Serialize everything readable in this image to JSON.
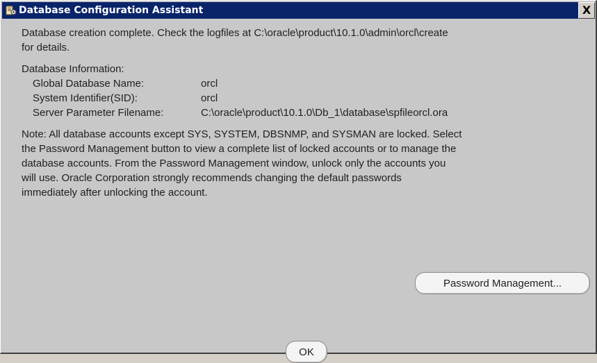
{
  "window": {
    "title": "Database Configuration Assistant",
    "close_label": "X",
    "title_icon": "database-assistant-icon"
  },
  "message": {
    "line1": "Database creation complete. Check the logfiles at C:\\oracle\\product\\10.1.0\\admin\\orcl\\create",
    "line2": "for details."
  },
  "info": {
    "heading": "Database Information:",
    "rows": [
      {
        "label": "Global Database Name:",
        "value": "orcl"
      },
      {
        "label": "System Identifier(SID):",
        "value": "orcl"
      },
      {
        "label": "Server Parameter Filename:",
        "value": "C:\\oracle\\product\\10.1.0\\Db_1\\database\\spfileorcl.ora"
      }
    ]
  },
  "note": {
    "lines": [
      "Note: All database accounts except SYS, SYSTEM, DBSNMP, and SYSMAN are locked. Select",
      "the Password Management button to view a complete list of locked accounts or to manage the",
      "database accounts. From the Password Management window, unlock only the accounts you",
      "will use. Oracle Corporation strongly recommends changing the default passwords",
      "immediately after unlocking the account."
    ]
  },
  "buttons": {
    "password_management": "Password Management...",
    "ok": "OK"
  },
  "colors": {
    "titlebar": "#0a246a",
    "window_bg": "#c8c8c8"
  }
}
